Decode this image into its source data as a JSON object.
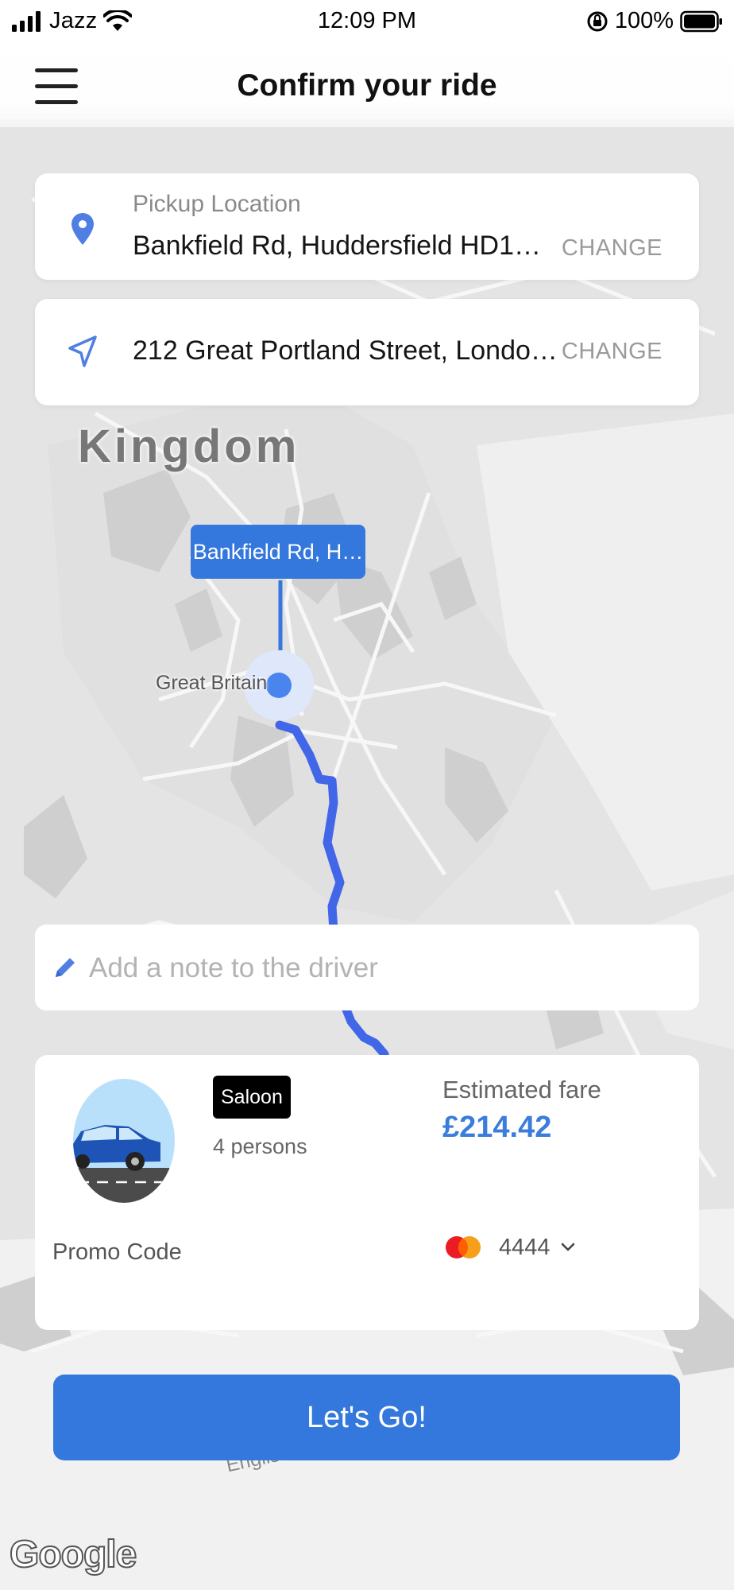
{
  "status_bar": {
    "carrier": "Jazz",
    "time": "12:09 PM",
    "battery": "100%"
  },
  "header": {
    "title": "Confirm your ride",
    "menu_icon": "hamburger-menu-icon"
  },
  "pickup": {
    "label": "Pickup Location",
    "value": "Bankfield Rd, Huddersfield HD1…",
    "change_label": "CHANGE",
    "icon": "location-pin-icon"
  },
  "destination": {
    "value": "212 Great Portland Street, London…",
    "change_label": "CHANGE",
    "icon": "navigation-arrow-icon"
  },
  "map": {
    "region_label": "Kingdom",
    "pin_label": "Bankfield Rd, H…",
    "place_label": "Great Britain",
    "sea_label": "English Channel",
    "logo": "Google",
    "route_color": "#4166e8"
  },
  "note": {
    "placeholder": "Add a note to the driver",
    "icon": "pencil-icon"
  },
  "ride": {
    "vehicle_type": "Saloon",
    "capacity": "4 persons",
    "fare_label": "Estimated fare",
    "fare_value": "£214.42",
    "promo_label": "Promo Code",
    "card_last4": "4444",
    "card_icon": "mastercard-icon"
  },
  "actions": {
    "go_label": "Let's Go!"
  },
  "colors": {
    "accent": "#3477dd",
    "fare": "#3a7ddb",
    "badge": "#000000"
  }
}
